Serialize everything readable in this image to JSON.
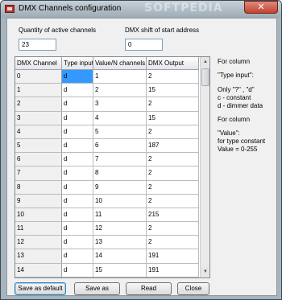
{
  "window": {
    "title": "DMX Channels configuration",
    "watermark": "SOFTPEDIA",
    "close_glyph": "✕"
  },
  "fields": {
    "quantity_label": "Quantity of active channels",
    "quantity_value": "23",
    "shift_label": "DMX shift of start address",
    "shift_value": "0"
  },
  "grid": {
    "columns": [
      "DMX Channel",
      "Type input",
      "Value/N channels",
      "DMX Output"
    ],
    "rows": [
      [
        "0",
        "d",
        "1",
        "2"
      ],
      [
        "1",
        "d",
        "2",
        "15"
      ],
      [
        "2",
        "d",
        "3",
        "2"
      ],
      [
        "3",
        "d",
        "4",
        "15"
      ],
      [
        "4",
        "d",
        "5",
        "2"
      ],
      [
        "5",
        "d",
        "6",
        "187"
      ],
      [
        "6",
        "d",
        "7",
        "2"
      ],
      [
        "7",
        "d",
        "8",
        "2"
      ],
      [
        "8",
        "d",
        "9",
        "2"
      ],
      [
        "9",
        "d",
        "10",
        "2"
      ],
      [
        "10",
        "d",
        "11",
        "215"
      ],
      [
        "11",
        "d",
        "12",
        "2"
      ],
      [
        "12",
        "d",
        "13",
        "2"
      ],
      [
        "13",
        "d",
        "14",
        "191"
      ],
      [
        "14",
        "d",
        "15",
        "191"
      ]
    ],
    "selected_row": 0,
    "selected_col": 1
  },
  "help": {
    "line1": "For column",
    "line2": "\"Type input\":",
    "line3": "Only \"?\" , \"d\"",
    "line4": "c - constant",
    "line5": "d - dimmer data",
    "line6": "For column",
    "line7": "\"Value\":",
    "line8": "for type constant",
    "line9": "Value = 0-255"
  },
  "buttons": {
    "save_default": "Save as default",
    "save_as": "Save as",
    "read": "Read",
    "close": "Close"
  },
  "colors": {
    "selection": "#3399ff",
    "titlebar": "#a8b4bd"
  }
}
